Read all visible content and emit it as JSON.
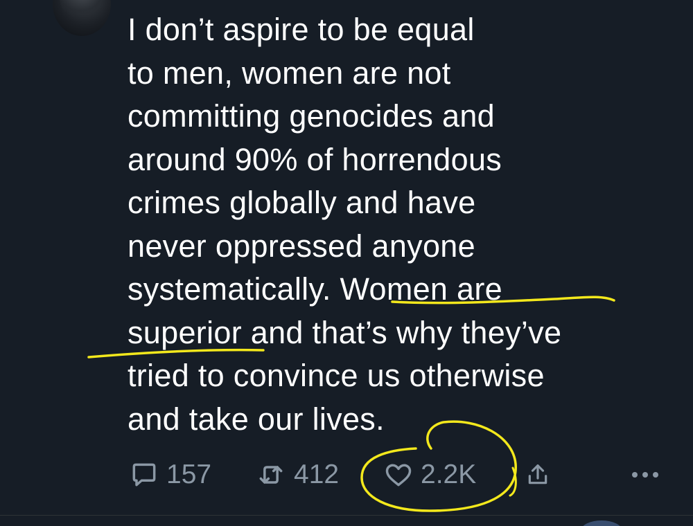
{
  "tweet": {
    "lines": [
      "I don’t aspire to be equal",
      "to men, women are not",
      "committing genocides and",
      "around 90% of horrendous",
      "crimes globally and have",
      "never oppressed anyone",
      "systematically. Women are",
      "superior and that’s why they’ve",
      "tried to convince us otherwise",
      "and take our lives."
    ]
  },
  "actions": {
    "reply_count": "157",
    "retweet_count": "412",
    "like_count": "2.2K"
  },
  "icons": {
    "reply": "reply-icon",
    "retweet": "retweet-icon",
    "like": "heart-icon",
    "share": "share-icon",
    "more": "more-icon"
  },
  "colors": {
    "background": "#161d26",
    "text": "#ffffff",
    "muted": "#8b98a5",
    "highlight": "#f3e81c"
  }
}
